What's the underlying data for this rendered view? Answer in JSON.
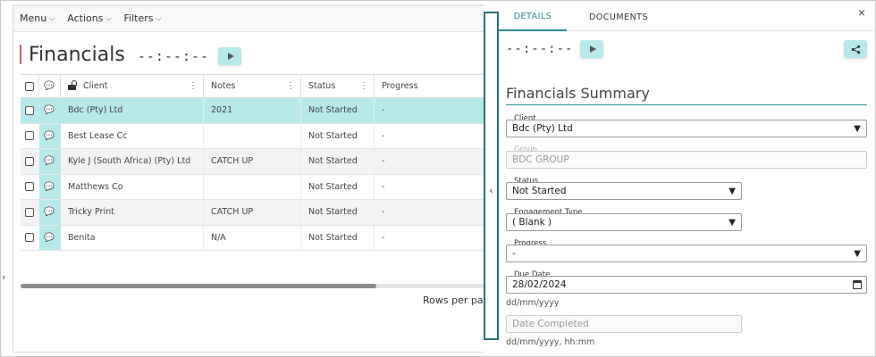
{
  "menubar": {
    "items": [
      {
        "label": "Menu"
      },
      {
        "label": "Actions"
      },
      {
        "label": "Filters"
      }
    ]
  },
  "header": {
    "title": "Financials",
    "timer": "--:--:--"
  },
  "grid": {
    "columns": {
      "client": "Client",
      "notes": "Notes",
      "status": "Status",
      "progress": "Progress"
    },
    "rows": [
      {
        "client": "Bdc (Pty) Ltd",
        "notes": "2021",
        "status": "Not Started",
        "progress": "-"
      },
      {
        "client": "Best Lease Cc",
        "notes": "",
        "status": "Not Started",
        "progress": "-"
      },
      {
        "client": "Kyle J (South Africa) (Pty) Ltd",
        "notes": "CATCH UP",
        "status": "Not Started",
        "progress": "-"
      },
      {
        "client": "Matthews Co",
        "notes": "",
        "status": "Not Started",
        "progress": "-"
      },
      {
        "client": "Tricky Print",
        "notes": "CATCH UP",
        "status": "Not Started",
        "progress": "-"
      },
      {
        "client": "Benita",
        "notes": "N/A",
        "status": "Not Started",
        "progress": "-"
      }
    ],
    "footer": "Rows per pag"
  },
  "detail": {
    "tabs": [
      {
        "label": "DETAILS"
      },
      {
        "label": "DOCUMENTS"
      }
    ],
    "close": "×",
    "timer": "--:--:--",
    "summary_title": "Financials Summary",
    "client": {
      "label": "Client",
      "value": "Bdc (Pty) Ltd"
    },
    "group": {
      "label": "Group",
      "value": "BDC GROUP"
    },
    "status": {
      "label": "Status",
      "value": "Not Started"
    },
    "engagement_type": {
      "label": "Engagement Type",
      "value": "( Blank )"
    },
    "progress": {
      "label": "Progress",
      "value": "-"
    },
    "due_date": {
      "label": "Due Date",
      "value": "28/02/2024",
      "helper": "dd/mm/yyyy"
    },
    "date_completed": {
      "placeholder": "Date Completed",
      "helper": "dd/mm/yyyy, hh:mm"
    }
  },
  "colors": {
    "accent": "#2a8a93",
    "selection": "#b7e9ea",
    "title_bar": "#e05a5a"
  }
}
